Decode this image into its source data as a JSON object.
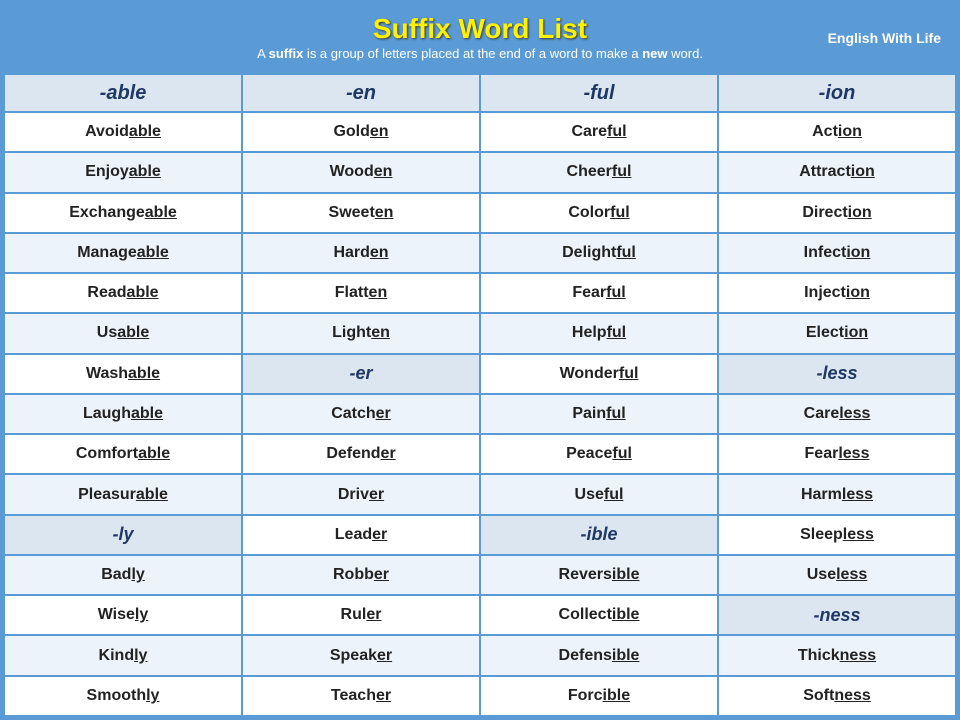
{
  "header": {
    "title": "Suffix Word List",
    "subtitle_start": "A ",
    "subtitle_bold1": "suffix",
    "subtitle_mid": " is a group of letters placed at the end of a word to make a ",
    "subtitle_bold2": "new",
    "subtitle_end": " word.",
    "brand": "English With Life"
  },
  "columns": [
    "-able",
    "-en",
    "-ful",
    "-ion"
  ],
  "rows": [
    [
      "Avoidable",
      "Golden",
      "Careful",
      "Action"
    ],
    [
      "Enjoyable",
      "Wooden",
      "Cheerful",
      "Attraction"
    ],
    [
      "Exchangeable",
      "Sweeten",
      "Colorful",
      "Direction"
    ],
    [
      "Manageable",
      "Harden",
      "Delightful",
      "Infection"
    ],
    [
      "Readable",
      "Flatten",
      "Fearful",
      "Injection"
    ],
    [
      "Usable",
      "Lighten",
      "Helpful",
      "Election"
    ],
    [
      "Washable",
      "-er",
      "Wonderful",
      "-less"
    ],
    [
      "Laughable",
      "Catcher",
      "Painful",
      "Careless"
    ],
    [
      "Comfortable",
      "Defender",
      "Peaceful",
      "Fearless"
    ],
    [
      "Pleasurable",
      "Driver",
      "Useful",
      "Harmless"
    ],
    [
      "-ly",
      "Leader",
      "-ible",
      "Sleepless"
    ],
    [
      "Badly",
      "Robber",
      "Reversible",
      "Useless"
    ],
    [
      "Wisely",
      "Ruler",
      "Collectible",
      "-ness"
    ],
    [
      "Kindly",
      "Speaker",
      "Defensible",
      "Thickness"
    ],
    [
      "Smoothly",
      "Teacher",
      "Forcible",
      "Softness"
    ]
  ],
  "sub_suffix_rows": [
    6,
    10,
    12
  ],
  "suffix_parts": {
    "Avoidable": "able",
    "Enjoyable": "able",
    "Exchangeable": "able",
    "Manageable": "able",
    "Readable": "able",
    "Usable": "able",
    "Washable": "able",
    "Laughable": "able",
    "Comfortable": "able",
    "Pleasurable": "able",
    "Golden": "en",
    "Wooden": "en",
    "Sweeten": "en",
    "Harden": "en",
    "Flatten": "en",
    "Lighten": "en",
    "Catcher": "er",
    "Defender": "er",
    "Driver": "er",
    "Leader": "er",
    "Robber": "er",
    "Ruler": "er",
    "Speaker": "er",
    "Teacher": "er",
    "Careful": "ful",
    "Cheerful": "ful",
    "Colorful": "ful",
    "Delightful": "ful",
    "Fearful": "ful",
    "Helpful": "ful",
    "Wonderful": "ful",
    "Painful": "ful",
    "Peaceful": "ful",
    "Useful": "ful",
    "Action": "ion",
    "Attraction": "ion",
    "Direction": "ion",
    "Infection": "ion",
    "Injection": "ion",
    "Election": "ion",
    "Careless": "less",
    "Fearless": "less",
    "Harmless": "less",
    "Sleepless": "less",
    "Useless": "less",
    "Badly": "ly",
    "Wisely": "ly",
    "Kindly": "ly",
    "Smoothly": "ly",
    "Reversible": "ible",
    "Collectible": "ible",
    "Defensible": "ible",
    "Forcible": "ible",
    "Thickness": "ness",
    "Softness": "ness"
  }
}
